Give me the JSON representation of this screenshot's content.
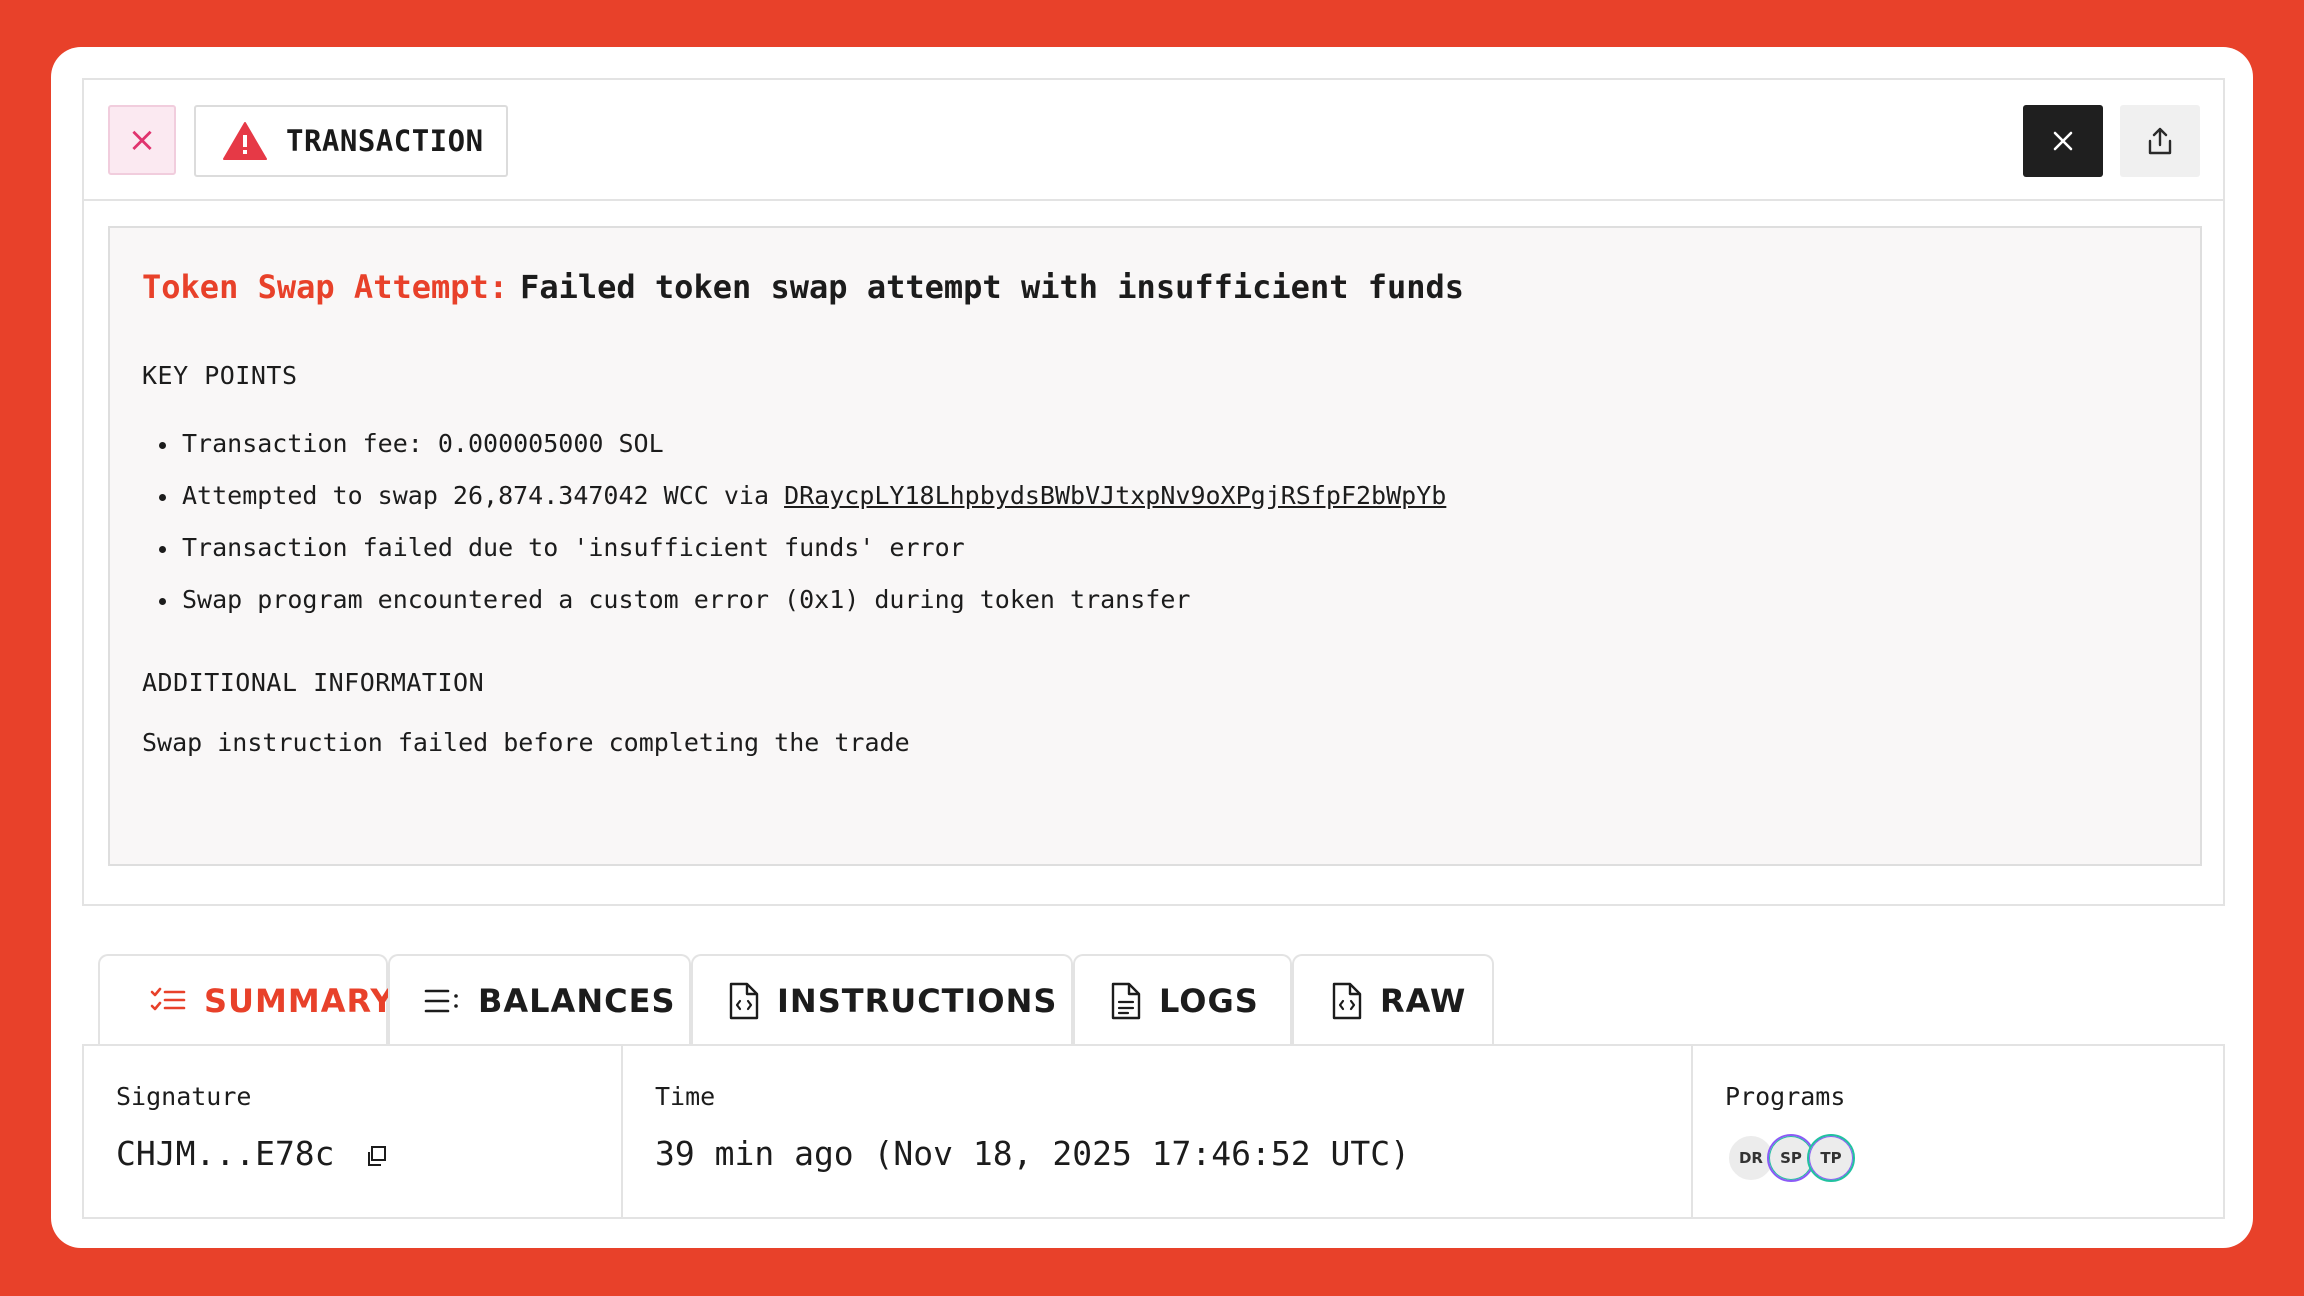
{
  "header": {
    "close_glyph": "×",
    "type_label": "TRANSACTION",
    "warning_icon": "warning-triangle-icon",
    "close_icon": "close-icon",
    "share_icon": "share-icon"
  },
  "summary": {
    "headline_prefix": "Token Swap Attempt:",
    "headline_text": "Failed token swap attempt with insufficient funds",
    "key_points_title": "KEY POINTS",
    "key_points": {
      "fee": "Transaction fee: 0.000005000 SOL",
      "swap_prefix": "Attempted to swap 26,874.347042 WCC via ",
      "swap_address": "DRaycpLY18LhpbydsBWbVJtxpNv9oXPgjRSfpF2bWpYb",
      "failure": "Transaction failed due to 'insufficient funds' error",
      "error": "Swap program encountered a custom error (0x1) during token transfer"
    },
    "additional_title": "ADDITIONAL INFORMATION",
    "additional_text": "Swap instruction failed before completing the trade"
  },
  "tabs": [
    {
      "label": "SUMMARY",
      "icon": "checklist-icon",
      "active": true
    },
    {
      "label": "BALANCES",
      "icon": "list-icon",
      "active": false
    },
    {
      "label": "INSTRUCTIONS",
      "icon": "code-file-icon",
      "active": false
    },
    {
      "label": "LOGS",
      "icon": "document-icon",
      "active": false
    },
    {
      "label": "RAW",
      "icon": "code-file-icon",
      "active": false
    }
  ],
  "info": {
    "signature_label": "Signature",
    "signature_value": "CHJM...E78c",
    "time_label": "Time",
    "time_value": "39 min ago (Nov 18, 2025 17:46:52 UTC)",
    "programs_label": "Programs",
    "programs": [
      "DR",
      "SP",
      "TP"
    ]
  },
  "colors": {
    "background": "#e8412a",
    "accent": "#e8412a",
    "warning": "#e63946",
    "pink": "#e0336e"
  }
}
